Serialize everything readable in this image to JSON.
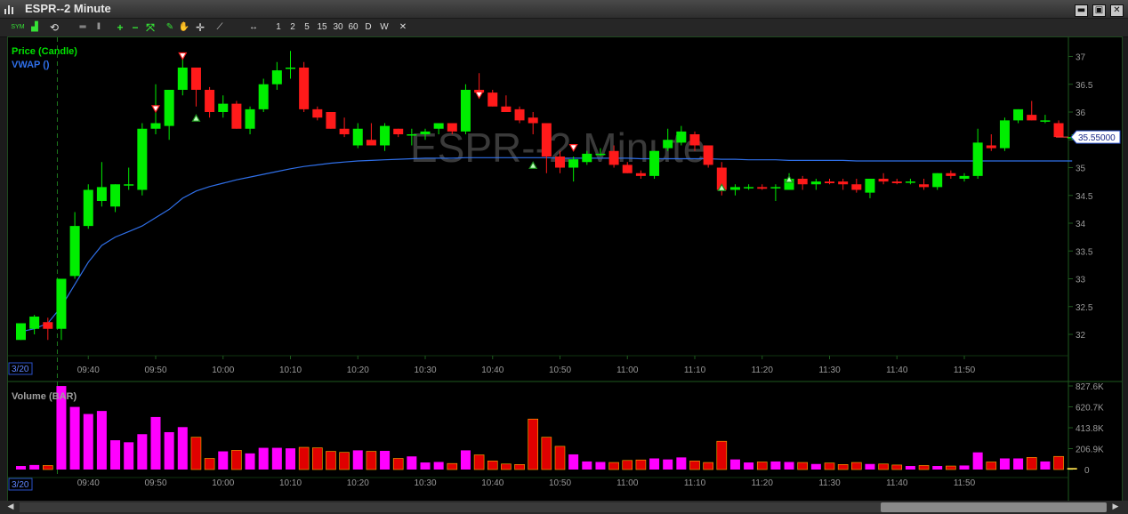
{
  "window": {
    "title": "ESPR--2 Minute",
    "minimize_label": "▬",
    "restore_label": "▣",
    "close_label": "✕"
  },
  "toolbar": {
    "items": [
      {
        "name": "symbol-icon",
        "label": "SYM"
      },
      {
        "name": "chart-type-icon",
        "label": "▟"
      },
      {
        "name": "refresh-icon",
        "label": "⟲"
      },
      {
        "name": "hlines-icon",
        "label": "═"
      },
      {
        "name": "vlines-icon",
        "label": "‖"
      },
      {
        "name": "zoom-in-icon",
        "label": "+"
      },
      {
        "name": "zoom-out-icon",
        "label": "−"
      },
      {
        "name": "fit-icon",
        "label": "⤧"
      },
      {
        "name": "pencil-icon",
        "label": "✎"
      },
      {
        "name": "hand-icon",
        "label": "✋"
      },
      {
        "name": "crosshair-icon",
        "label": "✛"
      },
      {
        "name": "line-tool-icon",
        "label": "⟋"
      },
      {
        "name": "pan-icon",
        "label": "↔"
      }
    ],
    "intervals": [
      "1",
      "2",
      "5",
      "15",
      "30",
      "60",
      "D",
      "W"
    ],
    "close_label": "✕"
  },
  "chart_data": {
    "type": "candlestick",
    "symbol": "ESPR",
    "interval": "2 Minute",
    "watermark": "ESPR--2 Minute",
    "date_label": "3/20",
    "price_panel": {
      "legend": [
        "Price (Candle)",
        "VWAP ()"
      ],
      "y_ticks": [
        32,
        32.5,
        33,
        33.5,
        34,
        34.5,
        35,
        35.5,
        36,
        36.5,
        37
      ],
      "y_tick_labels": [
        "32",
        "32.5",
        "33",
        "33.5",
        "34",
        "34.5",
        "35",
        "35.5",
        "36",
        "36.5",
        "37"
      ],
      "ylim": [
        31.6,
        37.2
      ],
      "last_price_label": "35.55000",
      "last_price": 35.55
    },
    "volume_panel": {
      "legend": "Volume (BAR)",
      "y_ticks": [
        0,
        206900,
        413800,
        620700,
        827600
      ],
      "y_tick_labels": [
        "0",
        "206.9K",
        "413.8K",
        "620.7K",
        "827.6K"
      ]
    },
    "x_time_labels": [
      "09:40",
      "09:50",
      "10:00",
      "10:10",
      "10:20",
      "10:30",
      "10:40",
      "10:50",
      "11:00",
      "11:10",
      "11:20",
      "11:30",
      "11:40",
      "11:50"
    ],
    "x_time_label_bar_index": [
      5,
      10,
      15,
      20,
      25,
      30,
      35,
      40,
      45,
      50,
      55,
      60,
      65,
      70
    ],
    "candles": [
      {
        "o": 31.9,
        "h": 32.2,
        "l": 31.9,
        "c": 32.2,
        "v": 35000
      },
      {
        "o": 32.1,
        "h": 32.35,
        "l": 32.0,
        "c": 32.32,
        "v": 45000
      },
      {
        "o": 32.22,
        "h": 32.3,
        "l": 31.9,
        "c": 32.1,
        "v": 40000
      },
      {
        "o": 32.1,
        "h": 33.0,
        "l": 31.9,
        "c": 33.0,
        "v": 827000
      },
      {
        "o": 33.05,
        "h": 34.2,
        "l": 33.0,
        "c": 33.95,
        "v": 620000
      },
      {
        "o": 33.95,
        "h": 34.7,
        "l": 33.9,
        "c": 34.6,
        "v": 550000
      },
      {
        "o": 34.4,
        "h": 35.1,
        "l": 34.3,
        "c": 34.65,
        "v": 580000
      },
      {
        "o": 34.3,
        "h": 34.7,
        "l": 34.2,
        "c": 34.7,
        "v": 290000
      },
      {
        "o": 34.7,
        "h": 35.0,
        "l": 34.6,
        "c": 34.7,
        "v": 270000
      },
      {
        "o": 34.6,
        "h": 35.8,
        "l": 34.5,
        "c": 35.7,
        "v": 350000
      },
      {
        "o": 35.7,
        "h": 36.5,
        "l": 35.6,
        "c": 35.8,
        "v": 520000
      },
      {
        "o": 35.75,
        "h": 36.4,
        "l": 35.5,
        "c": 36.4,
        "v": 370000
      },
      {
        "o": 36.4,
        "h": 37.0,
        "l": 36.3,
        "c": 36.8,
        "v": 420000
      },
      {
        "o": 36.8,
        "h": 36.8,
        "l": 36.1,
        "c": 36.4,
        "v": 320000
      },
      {
        "o": 36.4,
        "h": 36.45,
        "l": 35.9,
        "c": 36.0,
        "v": 110000
      },
      {
        "o": 36.0,
        "h": 36.3,
        "l": 35.9,
        "c": 36.15,
        "v": 180000
      },
      {
        "o": 36.15,
        "h": 36.2,
        "l": 35.7,
        "c": 35.7,
        "v": 190000
      },
      {
        "o": 35.7,
        "h": 36.1,
        "l": 35.6,
        "c": 36.05,
        "v": 160000
      },
      {
        "o": 36.05,
        "h": 36.6,
        "l": 36.0,
        "c": 36.5,
        "v": 215000
      },
      {
        "o": 36.5,
        "h": 36.9,
        "l": 36.4,
        "c": 36.75,
        "v": 215000
      },
      {
        "o": 36.8,
        "h": 37.1,
        "l": 36.6,
        "c": 36.8,
        "v": 210000
      },
      {
        "o": 36.8,
        "h": 36.9,
        "l": 36.0,
        "c": 36.05,
        "v": 220000
      },
      {
        "o": 36.05,
        "h": 36.1,
        "l": 35.85,
        "c": 35.9,
        "v": 215000
      },
      {
        "o": 36.0,
        "h": 36.0,
        "l": 35.7,
        "c": 35.7,
        "v": 180000
      },
      {
        "o": 35.7,
        "h": 35.9,
        "l": 35.55,
        "c": 35.6,
        "v": 170000
      },
      {
        "o": 35.4,
        "h": 35.8,
        "l": 35.35,
        "c": 35.7,
        "v": 190000
      },
      {
        "o": 35.5,
        "h": 35.8,
        "l": 35.4,
        "c": 35.4,
        "v": 180000
      },
      {
        "o": 35.4,
        "h": 35.8,
        "l": 35.3,
        "c": 35.75,
        "v": 185000
      },
      {
        "o": 35.7,
        "h": 35.7,
        "l": 35.55,
        "c": 35.6,
        "v": 110000
      },
      {
        "o": 35.6,
        "h": 35.7,
        "l": 35.4,
        "c": 35.6,
        "v": 130000
      },
      {
        "o": 35.6,
        "h": 35.7,
        "l": 35.5,
        "c": 35.65,
        "v": 70000
      },
      {
        "o": 35.7,
        "h": 35.8,
        "l": 35.6,
        "c": 35.8,
        "v": 75000
      },
      {
        "o": 35.8,
        "h": 35.8,
        "l": 35.6,
        "c": 35.65,
        "v": 60000
      },
      {
        "o": 35.65,
        "h": 36.5,
        "l": 35.6,
        "c": 36.4,
        "v": 190000
      },
      {
        "o": 36.4,
        "h": 36.7,
        "l": 36.3,
        "c": 36.35,
        "v": 145000
      },
      {
        "o": 36.35,
        "h": 36.4,
        "l": 36.1,
        "c": 36.1,
        "v": 85000
      },
      {
        "o": 36.1,
        "h": 36.3,
        "l": 36.0,
        "c": 36.0,
        "v": 55000
      },
      {
        "o": 36.05,
        "h": 36.1,
        "l": 35.8,
        "c": 35.85,
        "v": 50000
      },
      {
        "o": 35.9,
        "h": 36.0,
        "l": 35.6,
        "c": 35.8,
        "v": 500000
      },
      {
        "o": 35.8,
        "h": 35.8,
        "l": 34.9,
        "c": 35.2,
        "v": 320000
      },
      {
        "o": 35.2,
        "h": 35.3,
        "l": 34.9,
        "c": 35.0,
        "v": 230000
      },
      {
        "o": 35.0,
        "h": 35.2,
        "l": 34.75,
        "c": 35.15,
        "v": 150000
      },
      {
        "o": 35.1,
        "h": 35.3,
        "l": 35.05,
        "c": 35.25,
        "v": 80000
      },
      {
        "o": 35.25,
        "h": 35.35,
        "l": 35.2,
        "c": 35.25,
        "v": 75000
      },
      {
        "o": 35.3,
        "h": 35.4,
        "l": 35.0,
        "c": 35.05,
        "v": 70000
      },
      {
        "o": 35.05,
        "h": 35.1,
        "l": 34.9,
        "c": 34.9,
        "v": 90000
      },
      {
        "o": 34.9,
        "h": 34.95,
        "l": 34.8,
        "c": 34.85,
        "v": 95000
      },
      {
        "o": 34.85,
        "h": 35.3,
        "l": 34.8,
        "c": 35.3,
        "v": 110000
      },
      {
        "o": 35.35,
        "h": 35.7,
        "l": 35.3,
        "c": 35.5,
        "v": 100000
      },
      {
        "o": 35.45,
        "h": 35.75,
        "l": 35.4,
        "c": 35.65,
        "v": 120000
      },
      {
        "o": 35.6,
        "h": 35.65,
        "l": 35.3,
        "c": 35.4,
        "v": 85000
      },
      {
        "o": 35.4,
        "h": 35.4,
        "l": 35.0,
        "c": 35.05,
        "v": 70000
      },
      {
        "o": 35.0,
        "h": 35.1,
        "l": 34.5,
        "c": 34.6,
        "v": 280000
      },
      {
        "o": 34.6,
        "h": 34.7,
        "l": 34.5,
        "c": 34.65,
        "v": 100000
      },
      {
        "o": 34.65,
        "h": 34.7,
        "l": 34.6,
        "c": 34.65,
        "v": 70000
      },
      {
        "o": 34.65,
        "h": 34.7,
        "l": 34.6,
        "c": 34.62,
        "v": 75000
      },
      {
        "o": 34.65,
        "h": 34.7,
        "l": 34.4,
        "c": 34.65,
        "v": 80000
      },
      {
        "o": 34.6,
        "h": 34.9,
        "l": 34.6,
        "c": 34.8,
        "v": 75000
      },
      {
        "o": 34.8,
        "h": 34.85,
        "l": 34.6,
        "c": 34.7,
        "v": 70000
      },
      {
        "o": 34.7,
        "h": 34.8,
        "l": 34.6,
        "c": 34.75,
        "v": 55000
      },
      {
        "o": 34.75,
        "h": 34.8,
        "l": 34.7,
        "c": 34.72,
        "v": 65000
      },
      {
        "o": 34.75,
        "h": 34.8,
        "l": 34.6,
        "c": 34.7,
        "v": 50000
      },
      {
        "o": 34.7,
        "h": 34.8,
        "l": 34.55,
        "c": 34.6,
        "v": 70000
      },
      {
        "o": 34.55,
        "h": 34.8,
        "l": 34.45,
        "c": 34.8,
        "v": 55000
      },
      {
        "o": 34.8,
        "h": 34.9,
        "l": 34.7,
        "c": 34.75,
        "v": 55000
      },
      {
        "o": 34.75,
        "h": 34.8,
        "l": 34.7,
        "c": 34.72,
        "v": 45000
      },
      {
        "o": 34.75,
        "h": 34.8,
        "l": 34.7,
        "c": 34.75,
        "v": 35000
      },
      {
        "o": 34.7,
        "h": 34.8,
        "l": 34.6,
        "c": 34.65,
        "v": 40000
      },
      {
        "o": 34.65,
        "h": 34.9,
        "l": 34.6,
        "c": 34.9,
        "v": 35000
      },
      {
        "o": 34.9,
        "h": 34.95,
        "l": 34.8,
        "c": 34.85,
        "v": 35000
      },
      {
        "o": 34.8,
        "h": 34.9,
        "l": 34.75,
        "c": 34.85,
        "v": 40000
      },
      {
        "o": 34.85,
        "h": 35.7,
        "l": 34.8,
        "c": 35.45,
        "v": 170000
      },
      {
        "o": 35.4,
        "h": 35.6,
        "l": 35.3,
        "c": 35.35,
        "v": 75000
      },
      {
        "o": 35.35,
        "h": 35.9,
        "l": 35.3,
        "c": 35.85,
        "v": 110000
      },
      {
        "o": 35.85,
        "h": 36.05,
        "l": 35.8,
        "c": 36.05,
        "v": 110000
      },
      {
        "o": 35.95,
        "h": 36.2,
        "l": 35.85,
        "c": 35.85,
        "v": 120000
      },
      {
        "o": 35.85,
        "h": 35.95,
        "l": 35.8,
        "c": 35.85,
        "v": 80000
      },
      {
        "o": 35.8,
        "h": 35.85,
        "l": 35.55,
        "c": 35.55,
        "v": 130000
      },
      {
        "o": 35.55,
        "h": 35.6,
        "l": 35.5,
        "c": 35.55,
        "v": 15000
      }
    ],
    "vwap": [
      32.05,
      32.1,
      32.2,
      32.5,
      32.9,
      33.3,
      33.6,
      33.75,
      33.85,
      33.95,
      34.1,
      34.25,
      34.45,
      34.58,
      34.66,
      34.72,
      34.78,
      34.83,
      34.88,
      34.93,
      34.98,
      35.02,
      35.05,
      35.08,
      35.1,
      35.12,
      35.13,
      35.14,
      35.15,
      35.16,
      35.17,
      35.17,
      35.17,
      35.18,
      35.18,
      35.18,
      35.18,
      35.18,
      35.18,
      35.18,
      35.17,
      35.17,
      35.17,
      35.17,
      35.17,
      35.17,
      35.16,
      35.16,
      35.16,
      35.16,
      35.16,
      35.16,
      35.15,
      35.15,
      35.14,
      35.14,
      35.14,
      35.13,
      35.13,
      35.13,
      35.13,
      35.13,
      35.12,
      35.12,
      35.12,
      35.12,
      35.12,
      35.12,
      35.12,
      35.12,
      35.12,
      35.12,
      35.12,
      35.12,
      35.12,
      35.12,
      35.12,
      35.12,
      35.12
    ],
    "markers": [
      {
        "i": 10,
        "type": "sell",
        "price": 36.05
      },
      {
        "i": 12,
        "type": "sell",
        "price": 37.0
      },
      {
        "i": 13,
        "type": "buy",
        "price": 35.9
      },
      {
        "i": 34,
        "type": "sell",
        "price": 36.3
      },
      {
        "i": 38,
        "type": "buy",
        "price": 35.05
      },
      {
        "i": 41,
        "type": "sell",
        "price": 35.35
      },
      {
        "i": 52,
        "type": "buy",
        "price": 34.65
      },
      {
        "i": 57,
        "type": "buy",
        "price": 34.8
      }
    ],
    "colors": {
      "up": "#00ee00",
      "down": "#ff1a1a",
      "vwap": "#2f6fe8",
      "vol_pink": "#ff00ff",
      "vol_red": "#e00000",
      "vol_yellow": "#ffe14d",
      "grid_axis": "#1e5a1e",
      "tick_text": "#9a9a9a",
      "legend_price": "#00e000",
      "legend_vwap": "#2f6fe8"
    }
  }
}
